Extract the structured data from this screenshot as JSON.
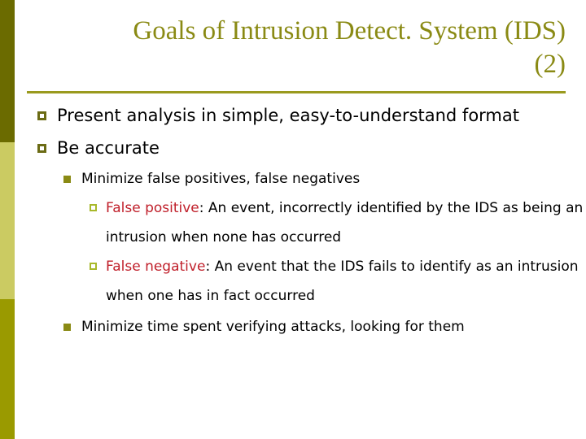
{
  "slide": {
    "title_line1": "Goals of Intrusion Detect. System (IDS)",
    "title_line2": "(2)",
    "title_color": "#8a8a14",
    "accent_color": "#9a9a1e",
    "emphasis_color": "#c0202b",
    "background_color": "#ffffff",
    "stripe": {
      "top_color": "#6b6b00",
      "mid_color": "#cbcb62",
      "bottom_color": "#9a9a00"
    },
    "bullets": [
      {
        "level": 1,
        "marker": "hollow-square-bullet-icon",
        "text": "Present analysis in simple, easy-to-understand format"
      },
      {
        "level": 1,
        "marker": "hollow-square-bullet-icon",
        "text": "Be accurate"
      },
      {
        "level": 2,
        "marker": "filled-square-bullet-icon",
        "text": "Minimize false positives, false negatives"
      },
      {
        "level": 3,
        "marker": "small-hollow-square-bullet-icon",
        "emphasis": "False positive",
        "text": ": An event, incorrectly identified by the IDS as being an intrusion when none has occurred"
      },
      {
        "level": 3,
        "marker": "small-hollow-square-bullet-icon",
        "emphasis": "False negative",
        "text": ": An event that the IDS fails to identify as an intrusion when one has in fact occurred"
      },
      {
        "level": 2,
        "marker": "filled-square-bullet-icon",
        "text": "Minimize time spent verifying attacks, looking for them"
      }
    ]
  }
}
